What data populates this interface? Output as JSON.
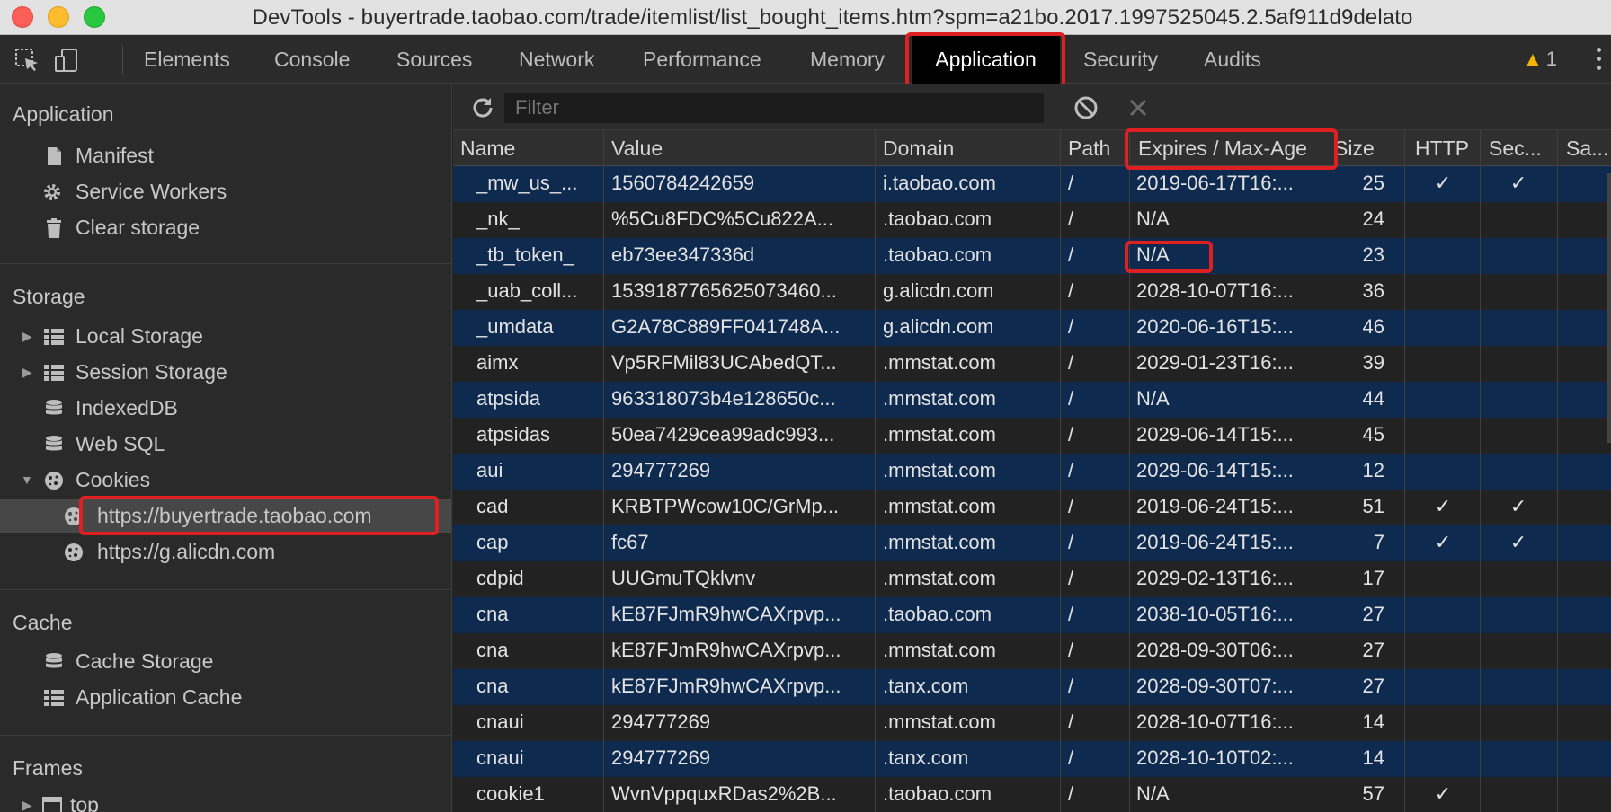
{
  "window": {
    "title": "DevTools - buyertrade.taobao.com/trade/itemlist/list_bought_items.htm?spm=a21bo.2017.1997525045.2.5af911d9delato"
  },
  "tabs": [
    "Elements",
    "Console",
    "Sources",
    "Network",
    "Performance",
    "Memory",
    "Application",
    "Security",
    "Audits"
  ],
  "active_tab": "Application",
  "warnings": {
    "count": "1",
    "icon": "warning-triangle-icon"
  },
  "sidebar": {
    "application": {
      "title": "Application",
      "items": [
        "Manifest",
        "Service Workers",
        "Clear storage"
      ]
    },
    "storage": {
      "title": "Storage",
      "items": [
        "Local Storage",
        "Session Storage",
        "IndexedDB",
        "Web SQL",
        "Cookies"
      ],
      "cookies": [
        "https://buyertrade.taobao.com",
        "https://g.alicdn.com"
      ],
      "selected": "https://buyertrade.taobao.com"
    },
    "cache": {
      "title": "Cache",
      "items": [
        "Cache Storage",
        "Application Cache"
      ]
    },
    "frames": {
      "title": "Frames",
      "items": [
        "top"
      ]
    }
  },
  "toolbar": {
    "filter_placeholder": "Filter"
  },
  "table": {
    "headers": [
      "Name",
      "Value",
      "Domain",
      "Path",
      "Expires / Max-Age",
      "Size",
      "HTTP",
      "Sec...",
      "Sa..."
    ],
    "rows": [
      {
        "name": "_mw_us_...",
        "value": "1560784242659",
        "domain": "i.taobao.com",
        "path": "/",
        "expires": "2019-06-17T16:...",
        "size": "25",
        "http": "✓",
        "secure": "✓"
      },
      {
        "name": "_nk_",
        "value": "%5Cu8FDC%5Cu822A...",
        "domain": ".taobao.com",
        "path": "/",
        "expires": "N/A",
        "size": "24",
        "http": "",
        "secure": ""
      },
      {
        "name": "_tb_token_",
        "value": "eb73ee347336d",
        "domain": ".taobao.com",
        "path": "/",
        "expires": "N/A",
        "size": "23",
        "http": "",
        "secure": ""
      },
      {
        "name": "_uab_coll...",
        "value": "1539187765625073460...",
        "domain": "g.alicdn.com",
        "path": "/",
        "expires": "2028-10-07T16:...",
        "size": "36",
        "http": "",
        "secure": ""
      },
      {
        "name": "_umdata",
        "value": "G2A78C889FF041748A...",
        "domain": "g.alicdn.com",
        "path": "/",
        "expires": "2020-06-16T15:...",
        "size": "46",
        "http": "",
        "secure": ""
      },
      {
        "name": "aimx",
        "value": "Vp5RFMil83UCAbedQT...",
        "domain": ".mmstat.com",
        "path": "/",
        "expires": "2029-01-23T16:...",
        "size": "39",
        "http": "",
        "secure": ""
      },
      {
        "name": "atpsida",
        "value": "963318073b4e128650c...",
        "domain": ".mmstat.com",
        "path": "/",
        "expires": "N/A",
        "size": "44",
        "http": "",
        "secure": ""
      },
      {
        "name": "atpsidas",
        "value": "50ea7429cea99adc993...",
        "domain": ".mmstat.com",
        "path": "/",
        "expires": "2029-06-14T15:...",
        "size": "45",
        "http": "",
        "secure": ""
      },
      {
        "name": "aui",
        "value": "294777269",
        "domain": ".mmstat.com",
        "path": "/",
        "expires": "2029-06-14T15:...",
        "size": "12",
        "http": "",
        "secure": ""
      },
      {
        "name": "cad",
        "value": "KRBTPWcow10C/GrMp...",
        "domain": ".mmstat.com",
        "path": "/",
        "expires": "2019-06-24T15:...",
        "size": "51",
        "http": "✓",
        "secure": "✓"
      },
      {
        "name": "cap",
        "value": "fc67",
        "domain": ".mmstat.com",
        "path": "/",
        "expires": "2019-06-24T15:...",
        "size": "7",
        "http": "✓",
        "secure": "✓"
      },
      {
        "name": "cdpid",
        "value": "UUGmuTQklvnv",
        "domain": ".mmstat.com",
        "path": "/",
        "expires": "2029-02-13T16:...",
        "size": "17",
        "http": "",
        "secure": ""
      },
      {
        "name": "cna",
        "value": "kE87FJmR9hwCAXrpvp...",
        "domain": ".taobao.com",
        "path": "/",
        "expires": "2038-10-05T16:...",
        "size": "27",
        "http": "",
        "secure": ""
      },
      {
        "name": "cna",
        "value": "kE87FJmR9hwCAXrpvp...",
        "domain": ".mmstat.com",
        "path": "/",
        "expires": "2028-09-30T06:...",
        "size": "27",
        "http": "",
        "secure": ""
      },
      {
        "name": "cna",
        "value": "kE87FJmR9hwCAXrpvp...",
        "domain": ".tanx.com",
        "path": "/",
        "expires": "2028-09-30T07:...",
        "size": "27",
        "http": "",
        "secure": ""
      },
      {
        "name": "cnaui",
        "value": "294777269",
        "domain": ".mmstat.com",
        "path": "/",
        "expires": "2028-10-07T16:...",
        "size": "14",
        "http": "",
        "secure": ""
      },
      {
        "name": "cnaui",
        "value": "294777269",
        "domain": ".tanx.com",
        "path": "/",
        "expires": "2028-10-10T02:...",
        "size": "14",
        "http": "",
        "secure": ""
      },
      {
        "name": "cookie1",
        "value": "WvnVppquxRDas2%2B...",
        "domain": ".taobao.com",
        "path": "/",
        "expires": "N/A",
        "size": "57",
        "http": "✓",
        "secure": ""
      }
    ]
  },
  "colors": {
    "highlight_outline": "#e02020",
    "selected_row": "#0f2a4f",
    "warning": "#f4b400"
  }
}
